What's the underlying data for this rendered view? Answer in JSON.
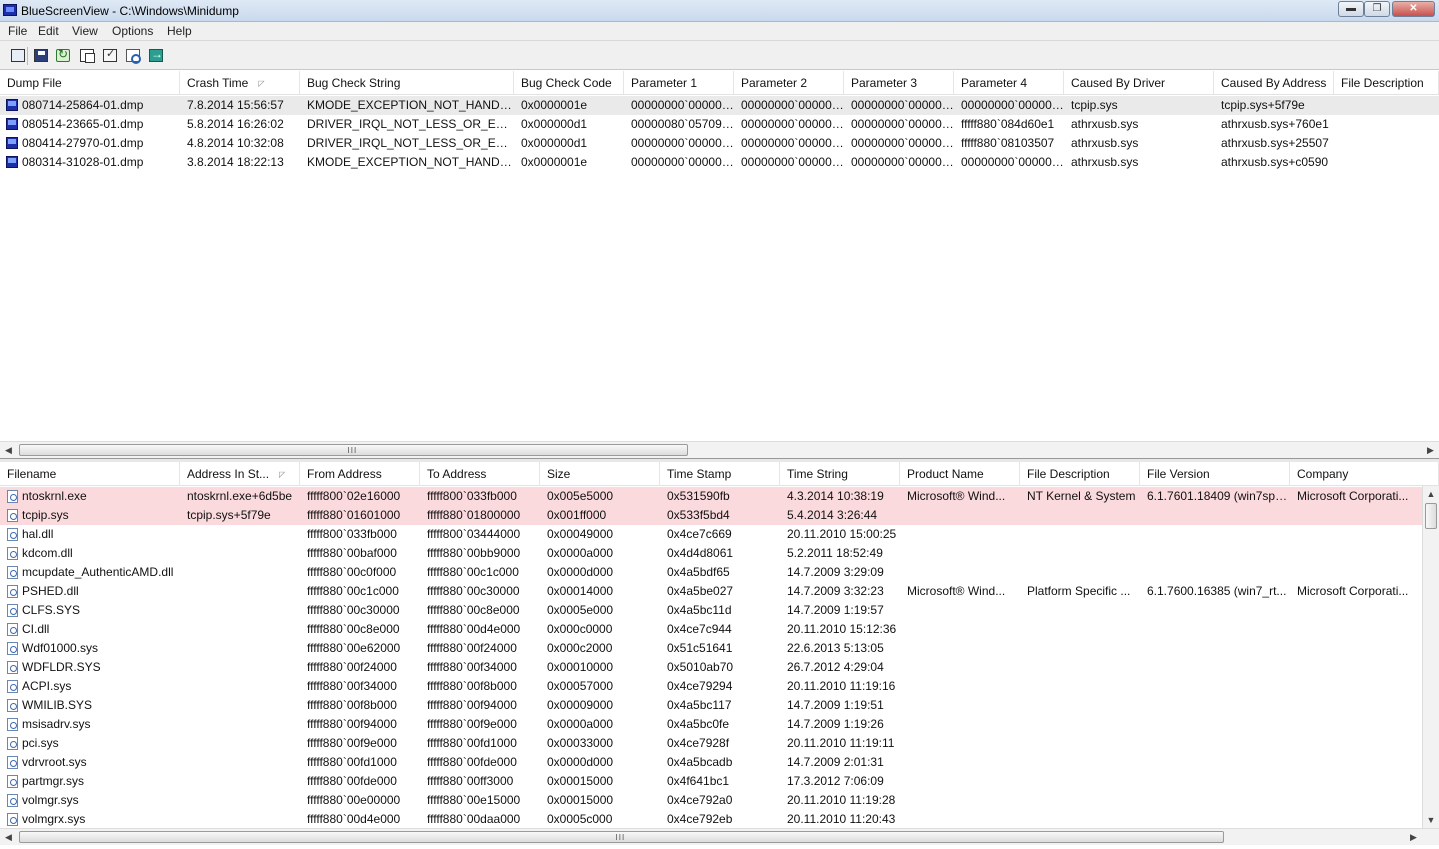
{
  "window": {
    "title": "BlueScreenView  -  C:\\Windows\\Minidump",
    "minimize_glyph": "▬",
    "maximize_glyph": "❐",
    "close_glyph": "✕",
    "icon": "bluescreen-app-icon"
  },
  "menu": [
    "File",
    "Edit",
    "View",
    "Options",
    "Help"
  ],
  "toolbar": {
    "buttons": [
      "html-report-icon",
      "save-icon",
      "refresh-icon",
      "copy-icon",
      "properties-icon",
      "find-icon",
      "exit-icon"
    ]
  },
  "dump_table": {
    "columns": [
      "Dump File",
      "Crash Time",
      "Bug Check String",
      "Bug Check Code",
      "Parameter 1",
      "Parameter 2",
      "Parameter 3",
      "Parameter 4",
      "Caused By Driver",
      "Caused By Address",
      "File Description"
    ],
    "sort_column_index": 1,
    "sort_glyph": "◸",
    "rows": [
      [
        "080714-25864-01.dmp",
        "7.8.2014 15:56:57",
        "KMODE_EXCEPTION_NOT_HANDLED",
        "0x0000001e",
        "00000000`000000...",
        "00000000`000000...",
        "00000000`000000...",
        "00000000`000000...",
        "tcpip.sys",
        "tcpip.sys+5f79e",
        ""
      ],
      [
        "080514-23665-01.dmp",
        "5.8.2014 16:26:02",
        "DRIVER_IRQL_NOT_LESS_OR_EQUAL",
        "0x000000d1",
        "00000080`057092...",
        "00000000`000000...",
        "00000000`000000...",
        "fffff880`084d60e1",
        "athrxusb.sys",
        "athrxusb.sys+760e1",
        ""
      ],
      [
        "080414-27970-01.dmp",
        "4.8.2014 10:32:08",
        "DRIVER_IRQL_NOT_LESS_OR_EQUAL",
        "0x000000d1",
        "00000000`000000...",
        "00000000`000000...",
        "00000000`000000...",
        "fffff880`08103507",
        "athrxusb.sys",
        "athrxusb.sys+25507",
        ""
      ],
      [
        "080314-31028-01.dmp",
        "3.8.2014 18:22:13",
        "KMODE_EXCEPTION_NOT_HANDLED",
        "0x0000001e",
        "00000000`000000...",
        "00000000`000000...",
        "00000000`000000...",
        "00000000`000000...",
        "athrxusb.sys",
        "athrxusb.sys+c0590",
        ""
      ]
    ],
    "selected_row_index": 0
  },
  "driver_table": {
    "columns": [
      "Filename",
      "Address In St...",
      "From Address",
      "To Address",
      "Size",
      "Time Stamp",
      "Time String",
      "Product Name",
      "File Description",
      "File Version",
      "Company"
    ],
    "sort_column_index": 1,
    "sort_glyph": "◸",
    "rows": [
      [
        "ntoskrnl.exe",
        "ntoskrnl.exe+6d5be",
        "fffff800`02e16000",
        "fffff800`033fb000",
        "0x005e5000",
        "0x531590fb",
        "4.3.2014 10:38:19",
        "Microsoft® Wind...",
        "NT Kernel & System",
        "6.1.7601.18409 (win7sp1...",
        "Microsoft Corporati..."
      ],
      [
        "tcpip.sys",
        "tcpip.sys+5f79e",
        "fffff880`01601000",
        "fffff880`01800000",
        "0x001ff000",
        "0x533f5bd4",
        "5.4.2014 3:26:44",
        "",
        "",
        "",
        ""
      ],
      [
        "hal.dll",
        "",
        "fffff800`033fb000",
        "fffff800`03444000",
        "0x00049000",
        "0x4ce7c669",
        "20.11.2010 15:00:25",
        "",
        "",
        "",
        ""
      ],
      [
        "kdcom.dll",
        "",
        "fffff880`00baf000",
        "fffff880`00bb9000",
        "0x0000a000",
        "0x4d4d8061",
        "5.2.2011 18:52:49",
        "",
        "",
        "",
        ""
      ],
      [
        "mcupdate_AuthenticAMD.dll",
        "",
        "fffff880`00c0f000",
        "fffff880`00c1c000",
        "0x0000d000",
        "0x4a5bdf65",
        "14.7.2009 3:29:09",
        "",
        "",
        "",
        ""
      ],
      [
        "PSHED.dll",
        "",
        "fffff880`00c1c000",
        "fffff880`00c30000",
        "0x00014000",
        "0x4a5be027",
        "14.7.2009 3:32:23",
        "Microsoft® Wind...",
        "Platform Specific ...",
        "6.1.7600.16385 (win7_rt...",
        "Microsoft Corporati..."
      ],
      [
        "CLFS.SYS",
        "",
        "fffff880`00c30000",
        "fffff880`00c8e000",
        "0x0005e000",
        "0x4a5bc11d",
        "14.7.2009 1:19:57",
        "",
        "",
        "",
        ""
      ],
      [
        "CI.dll",
        "",
        "fffff880`00c8e000",
        "fffff880`00d4e000",
        "0x000c0000",
        "0x4ce7c944",
        "20.11.2010 15:12:36",
        "",
        "",
        "",
        ""
      ],
      [
        "Wdf01000.sys",
        "",
        "fffff880`00e62000",
        "fffff880`00f24000",
        "0x000c2000",
        "0x51c51641",
        "22.6.2013 5:13:05",
        "",
        "",
        "",
        ""
      ],
      [
        "WDFLDR.SYS",
        "",
        "fffff880`00f24000",
        "fffff880`00f34000",
        "0x00010000",
        "0x5010ab70",
        "26.7.2012 4:29:04",
        "",
        "",
        "",
        ""
      ],
      [
        "ACPI.sys",
        "",
        "fffff880`00f34000",
        "fffff880`00f8b000",
        "0x00057000",
        "0x4ce79294",
        "20.11.2010 11:19:16",
        "",
        "",
        "",
        ""
      ],
      [
        "WMILIB.SYS",
        "",
        "fffff880`00f8b000",
        "fffff880`00f94000",
        "0x00009000",
        "0x4a5bc117",
        "14.7.2009 1:19:51",
        "",
        "",
        "",
        ""
      ],
      [
        "msisadrv.sys",
        "",
        "fffff880`00f94000",
        "fffff880`00f9e000",
        "0x0000a000",
        "0x4a5bc0fe",
        "14.7.2009 1:19:26",
        "",
        "",
        "",
        ""
      ],
      [
        "pci.sys",
        "",
        "fffff880`00f9e000",
        "fffff880`00fd1000",
        "0x00033000",
        "0x4ce7928f",
        "20.11.2010 11:19:11",
        "",
        "",
        "",
        ""
      ],
      [
        "vdrvroot.sys",
        "",
        "fffff880`00fd1000",
        "fffff880`00fde000",
        "0x0000d000",
        "0x4a5bcadb",
        "14.7.2009 2:01:31",
        "",
        "",
        "",
        ""
      ],
      [
        "partmgr.sys",
        "",
        "fffff880`00fde000",
        "fffff880`00ff3000",
        "0x00015000",
        "0x4f641bc1",
        "17.3.2012 7:06:09",
        "",
        "",
        "",
        ""
      ],
      [
        "volmgr.sys",
        "",
        "fffff880`00e00000",
        "fffff880`00e15000",
        "0x00015000",
        "0x4ce792a0",
        "20.11.2010 11:19:28",
        "",
        "",
        "",
        ""
      ],
      [
        "volmgrx.sys",
        "",
        "fffff880`00d4e000",
        "fffff880`00daa000",
        "0x0005c000",
        "0x4ce792eb",
        "20.11.2010 11:20:43",
        "",
        "",
        "",
        ""
      ]
    ],
    "highlighted_rows": [
      0,
      1
    ]
  },
  "scrollbars": {
    "left_arrow": "◀",
    "right_arrow": "▶",
    "up_arrow": "▲",
    "down_arrow": "▼",
    "grip": "III"
  },
  "colors": {
    "highlight_pink": "#fadadd",
    "selected_gray": "#eaeaea"
  }
}
